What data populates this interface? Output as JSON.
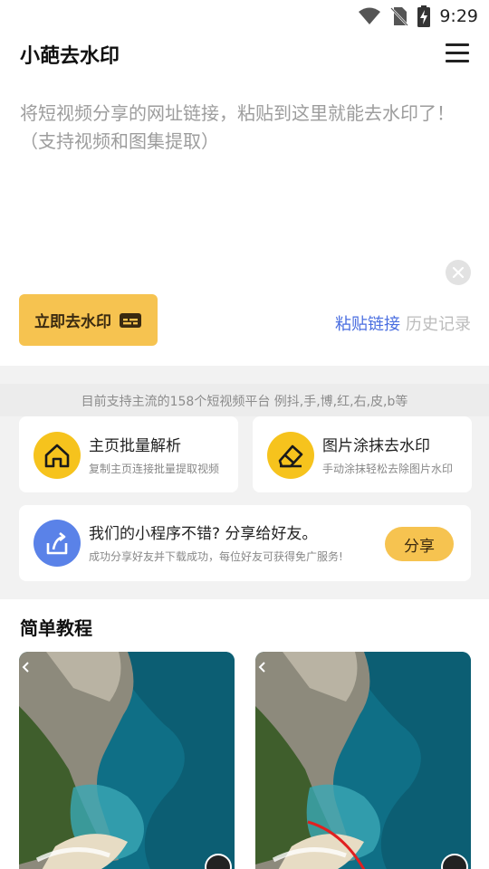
{
  "status_bar": {
    "time": "9:29",
    "icons": [
      "wifi-icon",
      "no-sim-icon",
      "battery-charging-icon"
    ]
  },
  "app_bar": {
    "title": "小葩去水印",
    "menu_icon": "hamburger-menu-icon"
  },
  "input": {
    "value": "",
    "placeholder": "将短视频分享的网址链接，粘贴到这里就能去水印了！（支持视频和图集提取）"
  },
  "actions": {
    "go_label": "立即去水印",
    "go_icon": "subtitle-box-icon",
    "paste_label": "粘贴链接",
    "history_label": "历史记录",
    "clear_icon": "close-circle-icon"
  },
  "support_note": "目前支持主流的158个短视频平台 例抖,手,博,红,右,皮,b等",
  "features": [
    {
      "title": "主页批量解析",
      "subtitle": "复制主页连接批量提取视频",
      "icon": "home-icon"
    },
    {
      "title": "图片涂抹去水印",
      "subtitle": "手动涂抹轻松去除图片水印",
      "icon": "eraser-icon"
    }
  ],
  "share": {
    "title": "我们的小程序不错? 分享给好友。",
    "subtitle": "成功分享好友并下载成功，每位好友可获得免广服务!",
    "button_label": "分享",
    "icon": "share-upload-icon"
  },
  "tutorial": {
    "title": "简单教程"
  },
  "colors": {
    "accent": "#f6c350",
    "icon_yellow": "#f6c31d",
    "link_blue": "#4a6ee0",
    "share_blue": "#5a82e8",
    "page_bg": "#f2f2f2"
  }
}
